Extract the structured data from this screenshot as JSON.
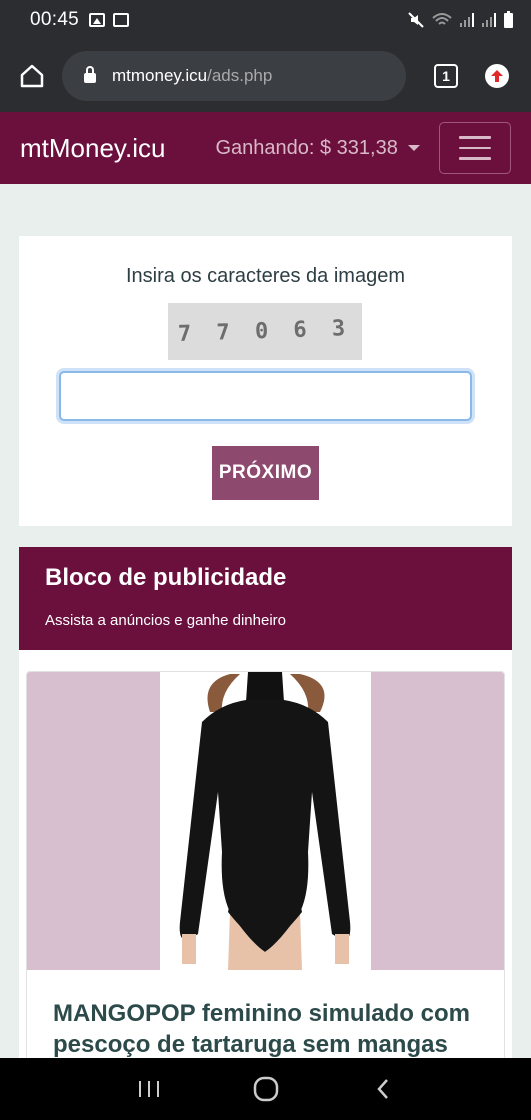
{
  "status_bar": {
    "time": "00:45",
    "icons": [
      "image-icon",
      "photo-id-icon",
      "mute-icon",
      "wifi-icon",
      "signal-icon",
      "signal-icon",
      "battery-icon"
    ]
  },
  "browser": {
    "url_domain": "mtmoney.icu",
    "url_path": "/ads.php",
    "tab_count": "1"
  },
  "site_nav": {
    "brand": "mtMoney.icu",
    "earnings_label": "Ganhando: $ 331,38",
    "colors": {
      "navbar": "#6b0f3d",
      "button": "#8e4a6e"
    }
  },
  "captcha": {
    "label": "Insira os caracteres da imagem",
    "image_text": "7 7 0 6 3",
    "input_value": "",
    "button_label": "PRÓXIMO"
  },
  "ad_block": {
    "title": "Bloco de publicidade",
    "subtitle": "Assista a anúncios e ganhe dinheiro",
    "product": {
      "title": "MANGOPOP feminino simulado com pescoço de tartaruga sem mangas"
    }
  }
}
